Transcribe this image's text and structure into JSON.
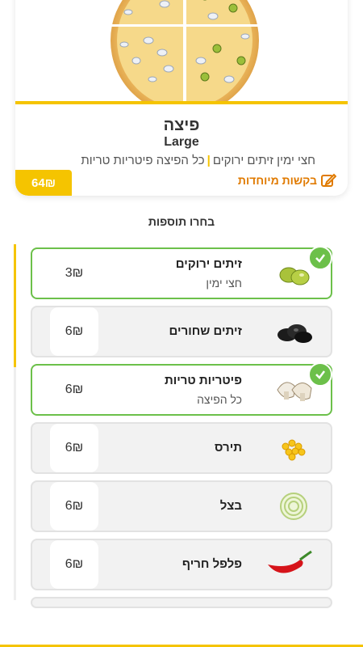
{
  "item": {
    "title": "פיצה",
    "size": "Large",
    "desc_part1": "חצי ימין זיתים ירוקים",
    "desc_sep": "|",
    "desc_part2": "כל הפיצה פיטריות טריות",
    "price": "64₪",
    "special_requests": "בקשות מיוחדות"
  },
  "section_title": "בחרו תוספות",
  "toppings": [
    {
      "name": "זיתים ירוקים",
      "sub": "חצי ימין",
      "price": "3₪",
      "selected": true,
      "icon": "green-olives-icon"
    },
    {
      "name": "זיתים שחורים",
      "sub": "",
      "price": "6₪",
      "selected": false,
      "icon": "black-olives-icon"
    },
    {
      "name": "פיטריות טריות",
      "sub": "כל הפיצה",
      "price": "6₪",
      "selected": true,
      "icon": "mushrooms-icon"
    },
    {
      "name": "תירס",
      "sub": "",
      "price": "6₪",
      "selected": false,
      "icon": "corn-icon"
    },
    {
      "name": "בצל",
      "sub": "",
      "price": "6₪",
      "selected": false,
      "icon": "onion-icon"
    },
    {
      "name": "פלפל חריף",
      "sub": "",
      "price": "6₪",
      "selected": false,
      "icon": "hot-pepper-icon"
    }
  ],
  "colors": {
    "accent": "#f5c400",
    "selected": "#6cc04a",
    "link": "#e07a00"
  }
}
